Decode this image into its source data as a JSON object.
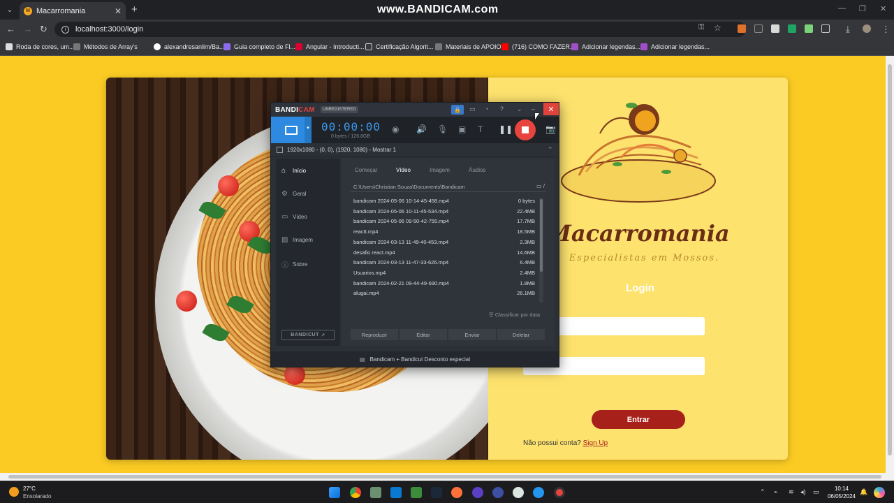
{
  "browser": {
    "tab_title": "Macarromania",
    "watermark": "www.BANDICAM.com",
    "url": "localhost:3000/login",
    "bookmarks": [
      "Roda de cores, um...",
      "Métodos de Array's",
      "alexandresanlim/Ba...",
      "Guia completo de Fl...",
      "Angular - Introducti...",
      "Certificação Algorit...",
      "Materiais de APOIO",
      "(716) COMO FAZER...",
      "Adicionar legendas...",
      "Adicionar legendas..."
    ],
    "icons": {
      "back": "arrow-left-icon",
      "forward": "arrow-right-icon",
      "reload": "reload-icon",
      "star": "star-icon",
      "download": "download-icon",
      "menu": "kebab-menu-icon"
    }
  },
  "page": {
    "brand": "Macarromania",
    "slogan": "Especialistas em Mossos.",
    "login_title": "Login",
    "enter_button": "Entrar",
    "signup_text": "Não possui conta?",
    "signup_link": "Sign Up",
    "colors": {
      "background": "#fbcb24",
      "panel": "#fde26e",
      "button": "#a8201a"
    }
  },
  "bandicam": {
    "logo_a": "BANDI",
    "logo_b": "CAM",
    "unregistered": "UNREGISTERED",
    "timer": "00:00:00",
    "bytes": "0 bytes / 126.8GB",
    "area": "1920x1080 - (0, 0), (1920, 1080) - Mostrar 1",
    "nav": [
      "Início",
      "Geral",
      "Vídeo",
      "Imagem",
      "Sobre"
    ],
    "tabs": [
      "Começar",
      "Vídeo",
      "Imagem",
      "Áudios"
    ],
    "path": "C:\\Users\\Christian Souza\\Documents\\Bandicam",
    "files": [
      {
        "name": "bandicam 2024-05-06 10-14-45-458.mp4",
        "size": "0 bytes"
      },
      {
        "name": "bandicam 2024-05-06 10-11-45-534.mp4",
        "size": "22.4MB"
      },
      {
        "name": "bandicam 2024-05-06 09-50-42-755.mp4",
        "size": "17.7MB"
      },
      {
        "name": "reactt.mp4",
        "size": "18.5MB"
      },
      {
        "name": "bandicam 2024-03-13 11-49-40-453.mp4",
        "size": "2.3MB"
      },
      {
        "name": "desafio react.mp4",
        "size": "14.6MB"
      },
      {
        "name": "bandicam 2024-03-13 11-47-33-626.mp4",
        "size": "6.4MB"
      },
      {
        "name": "Usuarios.mp4",
        "size": "2.4MB"
      },
      {
        "name": "bandicam 2024-02-21 09-44-49-690.mp4",
        "size": "1.8MB"
      },
      {
        "name": "alugai.mp4",
        "size": "26.1MB"
      }
    ],
    "sort": "Classificar por data",
    "actions": [
      "Reproduzir",
      "Editar",
      "Enviar",
      "Deletar"
    ],
    "bandicut": "BANDICUT",
    "promo": "Bandicam + Bandicut Desconto especial"
  },
  "taskbar": {
    "temperature": "27°C",
    "weather": "Ensolarado",
    "time": "10:14",
    "date": "06/05/2024"
  }
}
